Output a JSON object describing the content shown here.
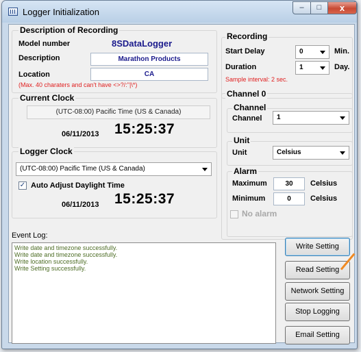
{
  "window": {
    "title": "Logger Initialization",
    "caption_min": "–",
    "caption_max": "□",
    "caption_close": "x"
  },
  "description": {
    "group_title": "Description of Recording",
    "model_label": "Model number",
    "model_value": "8SDataLogger",
    "description_label": "Description",
    "description_value": "Marathon Products",
    "location_label": "Location",
    "location_value": "CA",
    "warning": "(Max. 40 charaters and can't have <>?/:\"|\\*)"
  },
  "current_clock": {
    "group_title": "Current Clock",
    "timezone": "(UTC-08:00) Pacific Time (US & Canada)",
    "date": "06/11/2013",
    "time": "15:25:37"
  },
  "logger_clock": {
    "group_title": "Logger Clock",
    "timezone": "(UTC-08:00) Pacific Time (US & Canada)",
    "auto_adjust_label": "Auto Adjust Daylight Time",
    "auto_adjust_checked": true,
    "check_mark": "✓",
    "date": "06/11/2013",
    "time": "15:25:37"
  },
  "recording": {
    "group_title": "Recording",
    "start_delay_label": "Start Delay",
    "start_delay_value": "0",
    "start_delay_unit": "Min.",
    "duration_label": "Duration",
    "duration_value": "1",
    "duration_unit": "Day.",
    "sample_interval": "Sample interval: 2 sec."
  },
  "channel": {
    "section_title": "Channel 0",
    "channel_group_title": "Channel",
    "channel_label": "Channel",
    "channel_value": "1",
    "unit_group_title": "Unit",
    "unit_label": "Unit",
    "unit_value": "Celsius",
    "alarm_group_title": "Alarm",
    "maximum_label": "Maximum",
    "maximum_value": "30",
    "maximum_unit": "Celsius",
    "minimum_label": "Minimum",
    "minimum_value": "0",
    "minimum_unit": "Celsius",
    "no_alarm_label": "No alarm",
    "no_alarm_checked": false
  },
  "event_log": {
    "label": "Event Log:",
    "lines": [
      "Write date and timezone successfully.",
      "Write date and timezone successfully.",
      "Write location successfully.",
      "Write Setting successfully."
    ]
  },
  "actions": {
    "write_setting": "Write Setting",
    "read_setting": "Read Setting",
    "network_setting": "Network Setting",
    "stop_logging": "Stop Logging",
    "email_setting": "Email Setting"
  },
  "colors": {
    "model_value": "#1a1a8c",
    "warning": "#e02020",
    "log_text": "#4c6c24",
    "pointer": "#f08a24"
  }
}
